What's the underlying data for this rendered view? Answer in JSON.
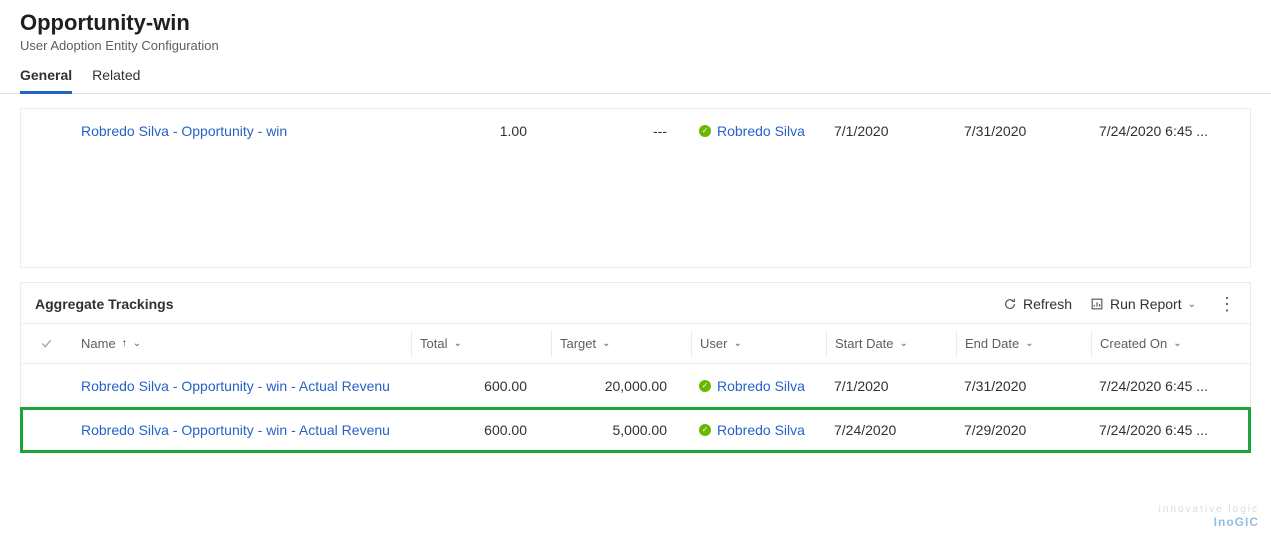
{
  "header": {
    "title": "Opportunity-win",
    "subtitle": "User Adoption Entity Configuration"
  },
  "tabs": [
    {
      "label": "General",
      "active": true
    },
    {
      "label": "Related",
      "active": false
    }
  ],
  "topGrid": {
    "rows": [
      {
        "name": "Robredo Silva - Opportunity - win",
        "total": "1.00",
        "target": "---",
        "user": "Robredo Silva",
        "start": "7/1/2020",
        "end": "7/31/2020",
        "created": "7/24/2020 6:45 ..."
      }
    ]
  },
  "bottomGrid": {
    "title": "Aggregate Trackings",
    "actions": {
      "refresh": "Refresh",
      "runReport": "Run Report"
    },
    "columns": {
      "name": "Name",
      "total": "Total",
      "target": "Target",
      "user": "User",
      "startDate": "Start Date",
      "endDate": "End Date",
      "createdOn": "Created On"
    },
    "rows": [
      {
        "name": "Robredo Silva - Opportunity - win - Actual Revenu",
        "total": "600.00",
        "target": "20,000.00",
        "user": "Robredo Silva",
        "start": "7/1/2020",
        "end": "7/31/2020",
        "created": "7/24/2020 6:45 ...",
        "highlight": false
      },
      {
        "name": "Robredo Silva - Opportunity - win - Actual Revenu",
        "total": "600.00",
        "target": "5,000.00",
        "user": "Robredo Silva",
        "start": "7/24/2020",
        "end": "7/29/2020",
        "created": "7/24/2020 6:45 ...",
        "highlight": true
      }
    ]
  },
  "logo": {
    "tag": "innovative logic",
    "brand": "InoGIC"
  }
}
